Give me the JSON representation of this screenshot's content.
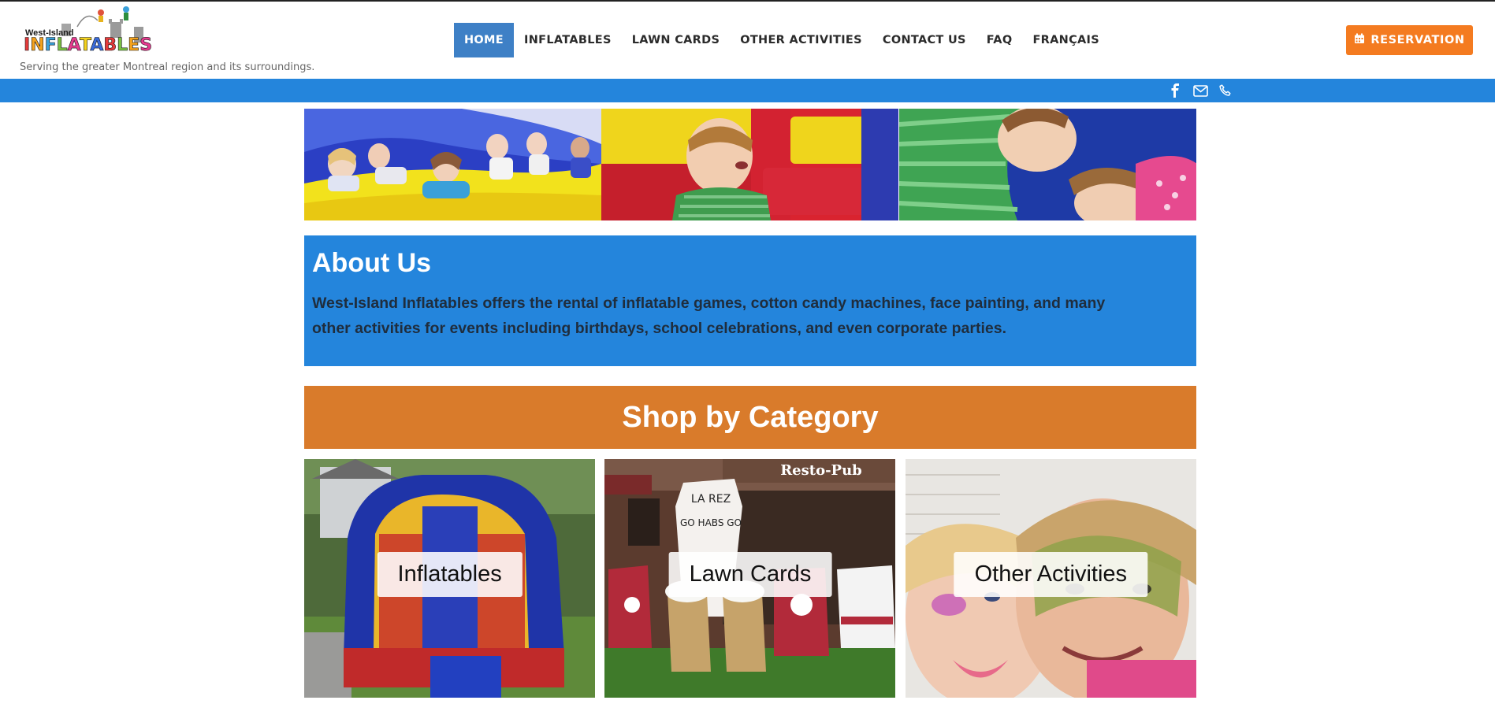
{
  "logo": {
    "small_text": "West-Island",
    "big_text": "INFLATABLES"
  },
  "tagline": "Serving the greater Montreal region and its surroundings.",
  "nav": {
    "items": [
      {
        "label": "HOME",
        "active": true
      },
      {
        "label": "INFLATABLES",
        "active": false
      },
      {
        "label": "LAWN CARDS",
        "active": false
      },
      {
        "label": "OTHER ACTIVITIES",
        "active": false
      },
      {
        "label": "CONTACT US",
        "active": false
      },
      {
        "label": "FAQ",
        "active": false
      },
      {
        "label": "FRANÇAIS",
        "active": false
      }
    ]
  },
  "reservation_button": {
    "label": "RESERVATION",
    "icon": "calendar-icon"
  },
  "social": [
    "facebook-icon",
    "mail-icon",
    "phone-icon"
  ],
  "about": {
    "title": "About Us",
    "text": "West-Island Inflatables offers the rental of inflatable games, cotton candy machines, face painting, and many other activities for events including birthdays, school celebrations, and even corporate parties."
  },
  "shop": {
    "title": "Shop by Category",
    "categories": [
      {
        "label": "Inflatables"
      },
      {
        "label": "Lawn Cards"
      },
      {
        "label": "Other Activities"
      }
    ]
  },
  "photo_text": {
    "resto_sign": "Resto-Pub",
    "jersey_text": "LA REZ",
    "jersey_slogan": "GO HABS GO"
  },
  "colors": {
    "brand_blue": "#2485dc",
    "nav_active": "#3e80c6",
    "reservation_orange": "#f47b20",
    "shop_orange": "#d97b2b"
  }
}
